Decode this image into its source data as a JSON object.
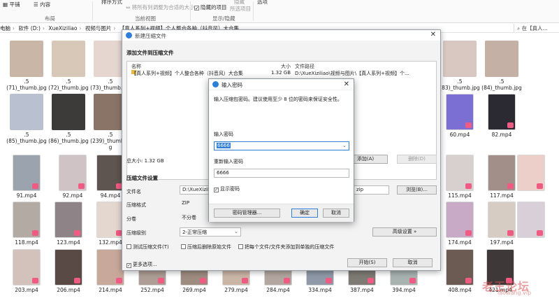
{
  "ribbon": {
    "items": [
      {
        "label": "平铺",
        "icon": "tiles-icon"
      },
      {
        "label": "内容",
        "icon": "content-icon"
      }
    ],
    "sort_label": "排序方式",
    "fit_columns_label": "将所有列调整为合适的大小",
    "hidden_items_label": "隐藏的项目",
    "hide_label": "隐藏",
    "hide_selected_label": "所选项目",
    "options_label": "选项",
    "group_layout": "布局",
    "group_current_view": "当前视图",
    "group_show_hide": "显示/隐藏"
  },
  "breadcrumbs": [
    "电脑",
    "软件 (D:)",
    "XueXiziliao",
    "视频与图片",
    "【真人系列+视频】个人整合各种（抖音风）大合集"
  ],
  "search_text": "在【真人...",
  "files": [
    {
      "name": ".5\n(71)_thumb.jpg",
      "color": "#c9b6a6"
    },
    {
      "name": ".5\n(72)_thumb.jpg",
      "color": "#d8c8b8"
    },
    {
      "name": ".5\n(73)_thumb.jpg",
      "color": "#e6d6d0"
    },
    {
      "name": ".5\n(85)_thumb.jpg",
      "color": "#b9c0cf"
    },
    {
      "name": ".5\n(86)_thumb.jpg",
      "color": "#3d3a3a"
    },
    {
      "name": ".5\n(239)_thumb.jp\ng",
      "color": "#8a7468"
    },
    {
      "name": "91.mp4",
      "color": "#9aa3ae"
    },
    {
      "name": "92.mp4",
      "color": "#cfc3c6"
    },
    {
      "name": "94.mp4",
      "color": "#5e5550"
    },
    {
      "name": "118.mp4",
      "color": "#b4aaa4"
    },
    {
      "name": "123.mp4",
      "color": "#8e8488"
    },
    {
      "name": "132.mp4",
      "color": "#e3d7cf"
    },
    {
      "name": "203.mp4",
      "color": "#d2c2bb"
    },
    {
      "name": "206.mp4",
      "color": "#5a4a46"
    },
    {
      "name": "214.mp4",
      "color": "#c7a89a"
    },
    {
      "name": "252.mp4",
      "color": "#ad9d94"
    },
    {
      "name": "269.mp4",
      "color": "#9e8c80"
    },
    {
      "name": "279.mp4",
      "color": "#cbb6a6"
    },
    {
      "name": "284.mp4",
      "color": "#b3a6a0"
    },
    {
      "name": "334.mp4",
      "color": "#8f99a8"
    },
    {
      "name": "387.mp4",
      "color": "#7e7a74"
    },
    {
      "name": "394.mp4",
      "color": "#a8b3b0"
    },
    {
      "name": "408.mp4",
      "color": "#6b5b52"
    },
    {
      "name": "421.mp4",
      "color": "#3e3838"
    },
    {
      "name": ".5\n(83)_thumb.jpg",
      "color": "#d9c8c2"
    },
    {
      "name": ".5\n(84)_thumb.jpg",
      "color": "#c5b0a6"
    },
    {
      "name": "60.mp4",
      "color": "#7c6fd3"
    },
    {
      "name": "82.mp4",
      "color": "#2b2a33"
    },
    {
      "name": "115.mp4",
      "color": "#d8cfcf"
    },
    {
      "name": "117.mp4",
      "color": "#a38f8a"
    },
    {
      "name": "174.mp4",
      "color": "#c8a9c6"
    },
    {
      "name": "197.mp4",
      "color": "#d7ccc4"
    },
    {
      "name": "thumb_b1",
      "color": "#eccfc9"
    },
    {
      "name": "thumb_b2",
      "color": "#d8cfd8"
    },
    {
      "name": "thumb_b3",
      "color": "#b9a098"
    }
  ],
  "main_dialog": {
    "title": "新建压缩文件",
    "section_add": "添加文件到压缩文件",
    "col_name": "名称",
    "col_size": "大小",
    "col_path": "文件路径",
    "row_name": "【真人系列+视频】个人整合各种（抖音风）大合集",
    "row_size": "1.32 GB",
    "row_path": "D:\\XueXiziliao\\视频与图片\\【真人系列+视频】个...",
    "total_size": "总大小: 1.32 GB",
    "add_button": "添加(A)",
    "delete_button": "删除(D)",
    "section_settings": "压缩文件设置",
    "filename_label": "文件名",
    "filename_value": "D:\\XueXizili",
    "filename_ext": "zip",
    "browse_button": "浏览(B)...",
    "format_label": "压缩格式",
    "format_value": "ZIP",
    "volume_label": "分卷",
    "volume_value": "不分卷",
    "level_label": "压缩级别",
    "level_value": "2-正常压缩",
    "advanced_button": "高级设置 »",
    "test_label": "测试压缩文件(T)",
    "delete_after_label": "压缩后删除原始文件",
    "each_separate_label": "把每个文件/文件夹添加到单独的压缩文件",
    "more_options_label": "更多选项...",
    "start_button": "开始(S)",
    "cancel_button": "取消"
  },
  "password_dialog": {
    "title": "输入密码",
    "hint": "输入压缩包密码。建议使用至少 8 位的密码来保证安全性。",
    "enter_label": "输入密码",
    "enter_value": "6666",
    "reenter_label": "重新输入密码",
    "reenter_value": "6666",
    "show_password_label": "显示密码",
    "manager_button": "密码管理器...",
    "ok_button": "确定",
    "cancel_button": "取消"
  },
  "watermark": {
    "text": "老王论坛",
    "url": "laowang.vip"
  },
  "colors": {
    "accent": "#2f7fd8",
    "badge": "#f05b83",
    "dialog_bg": "#f3f3f3"
  }
}
